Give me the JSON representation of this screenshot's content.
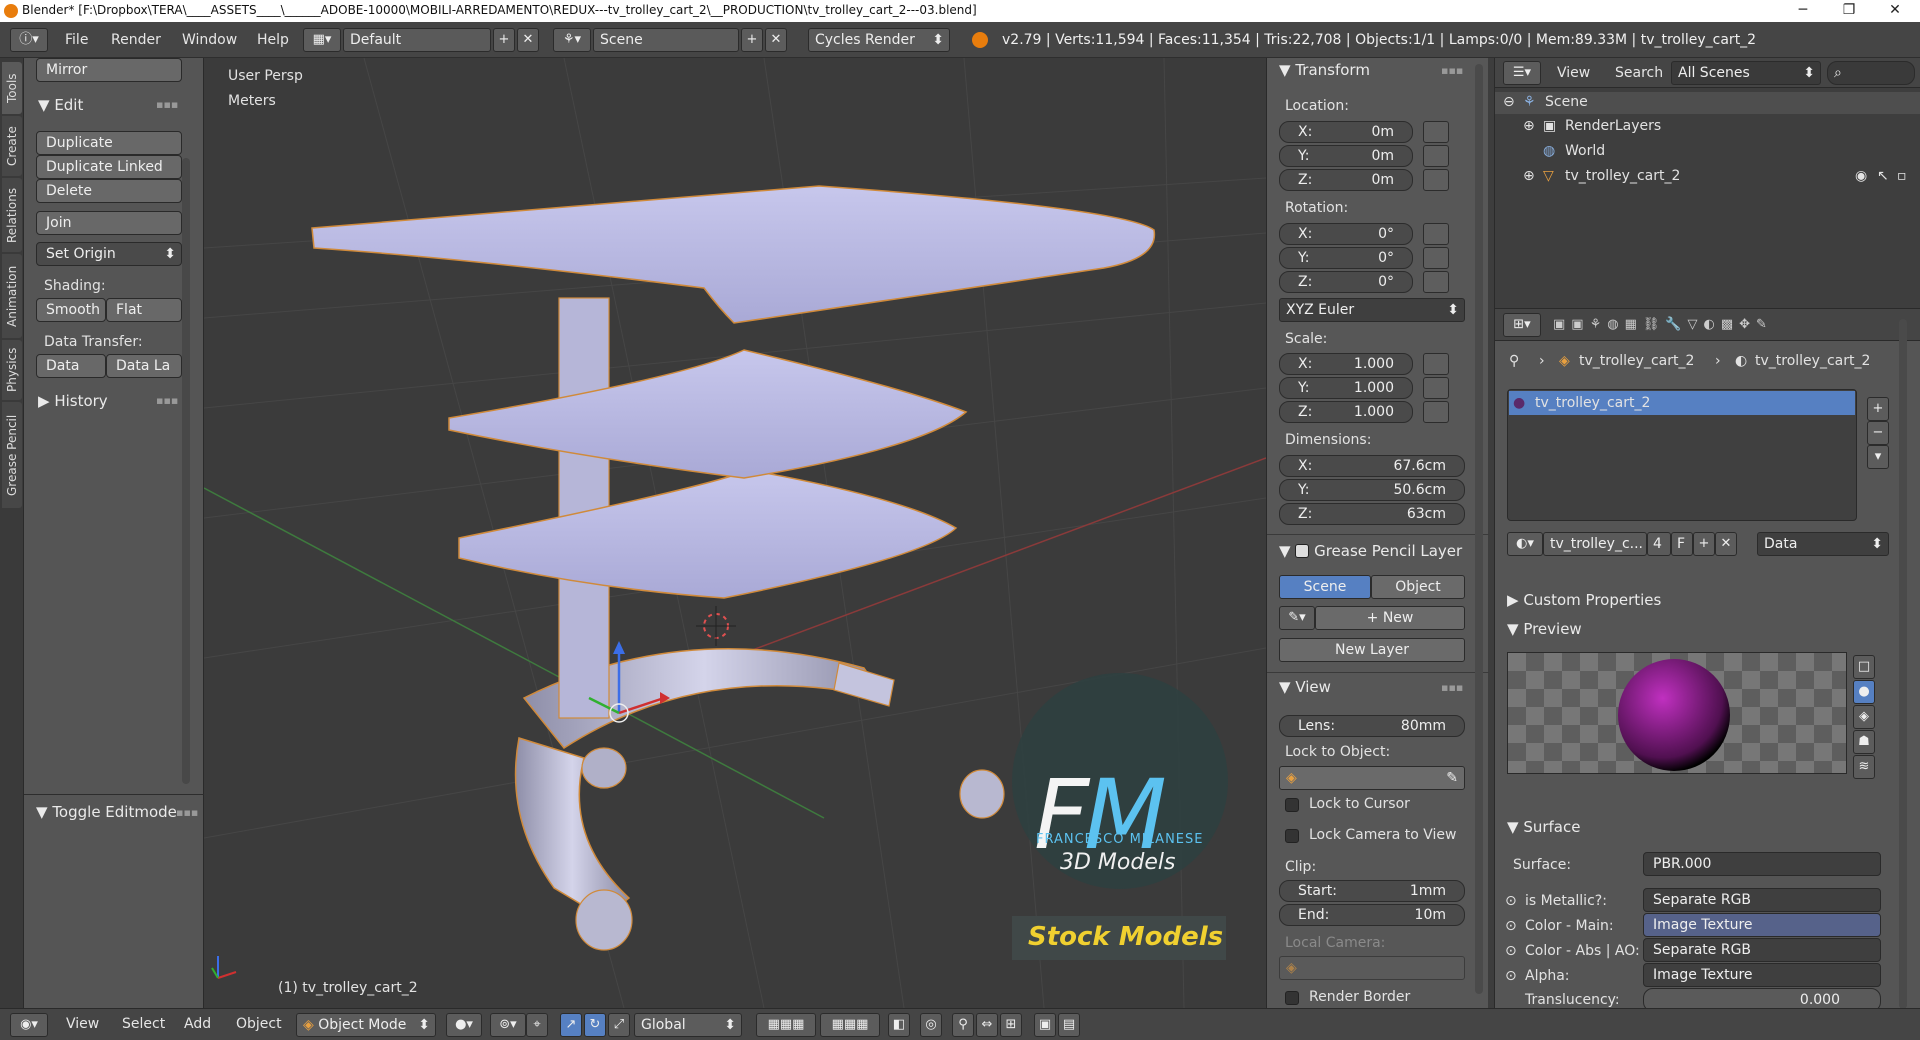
{
  "titlebar": {
    "title": "Blender* [F:\\Dropbox\\TERA\\____ASSETS____\\______ADOBE-10000\\MOBILI-ARREDAMENTO\\REDUX---tv_trolley_cart_2\\__PRODUCTION\\tv_trolley_cart_2---03.blend]",
    "minimize": "─",
    "maximize": "❐",
    "close": "✕"
  },
  "infobar": {
    "menus": [
      "File",
      "Render",
      "Window",
      "Help"
    ],
    "layout": "Default",
    "scene": "Scene",
    "engine": "Cycles Render",
    "stats": "v2.79 | Verts:11,594 | Faces:11,354 | Tris:22,708 | Objects:1/1 | Lamps:0/0 | Mem:89.33M | tv_trolley_cart_2"
  },
  "lefttabs": [
    "Tools",
    "Create",
    "Relations",
    "Animation",
    "Physics",
    "Grease Pencil"
  ],
  "toolshelf": {
    "mirror": "Mirror",
    "edit_header": "Edit",
    "duplicate": "Duplicate",
    "duplicate_linked": "Duplicate Linked",
    "delete": "Delete",
    "join": "Join",
    "set_origin": "Set Origin",
    "shading_label": "Shading:",
    "smooth": "Smooth",
    "flat": "Flat",
    "data_transfer_label": "Data Transfer:",
    "data": "Data",
    "data_la": "Data La",
    "history_header": "History",
    "toggle_editmode": "Toggle Editmode"
  },
  "viewport": {
    "view_name": "User Persp",
    "units": "Meters",
    "object_label": "(1) tv_trolley_cart_2",
    "watermark_big": "FM",
    "watermark_name": "FRANCESCO MILANESE",
    "watermark_sub": "3D Models",
    "watermark_stock": "Stock Models"
  },
  "npanel": {
    "transform_header": "Transform",
    "location_label": "Location:",
    "location": [
      {
        "k": "X:",
        "v": "0m"
      },
      {
        "k": "Y:",
        "v": "0m"
      },
      {
        "k": "Z:",
        "v": "0m"
      }
    ],
    "rotation_label": "Rotation:",
    "rotation": [
      {
        "k": "X:",
        "v": "0°"
      },
      {
        "k": "Y:",
        "v": "0°"
      },
      {
        "k": "Z:",
        "v": "0°"
      }
    ],
    "rotation_mode": "XYZ Euler",
    "scale_label": "Scale:",
    "scale": [
      {
        "k": "X:",
        "v": "1.000"
      },
      {
        "k": "Y:",
        "v": "1.000"
      },
      {
        "k": "Z:",
        "v": "1.000"
      }
    ],
    "dimensions_label": "Dimensions:",
    "dimensions": [
      {
        "k": "X:",
        "v": "67.6cm"
      },
      {
        "k": "Y:",
        "v": "50.6cm"
      },
      {
        "k": "Z:",
        "v": "63cm"
      }
    ],
    "grease_header": "Grease Pencil Layer",
    "scene_btn": "Scene",
    "object_btn": "Object",
    "new_btn": "New",
    "new_layer_btn": "New Layer",
    "view_header": "View",
    "lens_k": "Lens:",
    "lens_v": "80mm",
    "lock_to_object": "Lock to Object:",
    "lock_to_cursor": "Lock to Cursor",
    "lock_camera": "Lock Camera to View",
    "clip_label": "Clip:",
    "clip_start_k": "Start:",
    "clip_start_v": "1mm",
    "clip_end_k": "End:",
    "clip_end_v": "10m",
    "local_camera": "Local Camera:",
    "render_border": "Render Border"
  },
  "outliner": {
    "view": "View",
    "search": "Search",
    "all_scenes": "All Scenes",
    "tree": [
      "Scene",
      "RenderLayers",
      "World",
      "tv_trolley_cart_2"
    ]
  },
  "props": {
    "breadcrumb_obj": "tv_trolley_cart_2",
    "breadcrumb_mat": "tv_trolley_cart_2",
    "slot_name": "tv_trolley_cart_2",
    "mat_name": "tv_trolley_c...",
    "users": "4",
    "fake": "F",
    "link": "Data",
    "custom_props": "Custom Properties",
    "preview": "Preview",
    "surface_header": "Surface",
    "surface_label": "Surface:",
    "surface_value": "PBR.000",
    "rows": [
      {
        "label": "is Metallic?:",
        "value": "Separate RGB"
      },
      {
        "label": "Color - Main:",
        "value": "Image Texture"
      },
      {
        "label": "Color - Abs | AO:",
        "value": "Separate RGB"
      },
      {
        "label": "Alpha:",
        "value": "Image Texture"
      }
    ],
    "translucency_label": "Translucency:",
    "translucency_value": "0.000"
  },
  "bottombar": {
    "view": "View",
    "select": "Select",
    "add": "Add",
    "object": "Object",
    "mode": "Object Mode",
    "orientation": "Global"
  }
}
